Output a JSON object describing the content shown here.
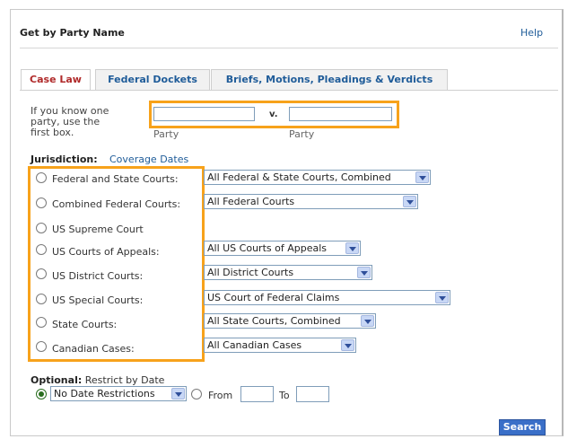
{
  "header": {
    "title": "Get by Party Name",
    "help_link": "Help"
  },
  "tabs": [
    {
      "label": "Case Law",
      "active": true
    },
    {
      "label": "Federal Dockets",
      "active": false
    },
    {
      "label": "Briefs, Motions, Pleadings & Verdicts",
      "active": false
    }
  ],
  "party": {
    "hint": "If you know one party, use the first box.",
    "party1_value": "",
    "party2_value": "",
    "separator": "v.",
    "party1_label": "Party",
    "party2_label": "Party"
  },
  "jurisdiction": {
    "label": "Jurisdiction:",
    "coverage_link": "Coverage Dates",
    "options": [
      {
        "label": "Federal and State Courts:",
        "selected": false,
        "select_value": "All Federal & State Courts, Combined"
      },
      {
        "label": "Combined Federal Courts:",
        "selected": false,
        "select_value": "All Federal Courts"
      },
      {
        "label": "US Supreme Court",
        "selected": false,
        "select_value": null
      },
      {
        "label": "US Courts of Appeals:",
        "selected": false,
        "select_value": "All US Courts of Appeals"
      },
      {
        "label": "US District Courts:",
        "selected": false,
        "select_value": "All District Courts"
      },
      {
        "label": "US Special Courts:",
        "selected": false,
        "select_value": "US Court of Federal Claims"
      },
      {
        "label": "State Courts:",
        "selected": false,
        "select_value": "All State Courts, Combined"
      },
      {
        "label": "Canadian Cases:",
        "selected": false,
        "select_value": "All Canadian Cases"
      }
    ]
  },
  "date": {
    "optional": "Optional:",
    "restrict": "Restrict by Date",
    "option1_selected": true,
    "restriction_value": "No Date Restrictions",
    "option2_selected": false,
    "from_label": "From",
    "from_value": "",
    "to_label": "To",
    "to_value": ""
  },
  "search_button": "Search",
  "colors": {
    "highlight": "#f7a21b",
    "link": "#1f5c99",
    "active_tab": "#b02a2a",
    "button": "#3a6fc8"
  }
}
